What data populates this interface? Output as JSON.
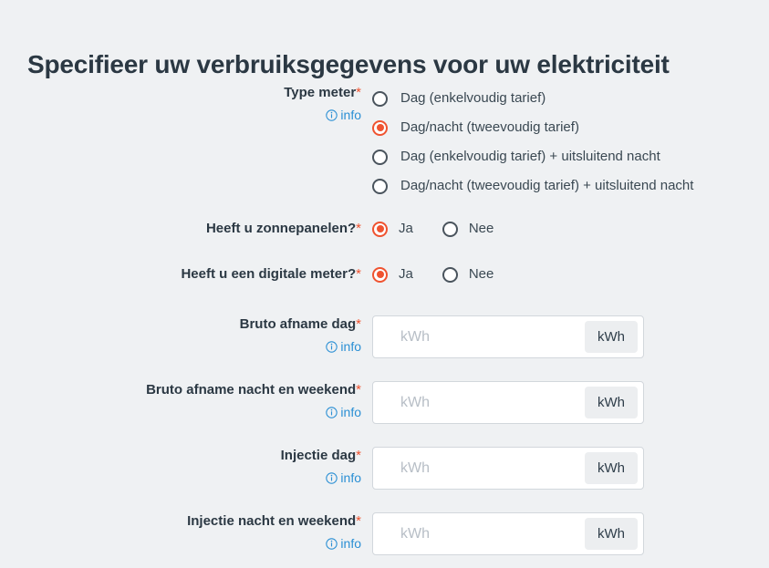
{
  "page": {
    "title": "Specifieer uw verbruiksgegevens voor uw elektriciteit",
    "background_color": "#eff1f3",
    "accent_color": "#ef5330",
    "link_color": "#2a8fd4",
    "required_marker": "*",
    "info_label": "info",
    "info_icon": "info-circle-icon"
  },
  "fields": {
    "meter_type": {
      "label": "Type meter",
      "required_marker": "*",
      "info_label": "info",
      "options": [
        {
          "label": "Dag (enkelvoudig tarief)",
          "selected": false
        },
        {
          "label": "Dag/nacht (tweevoudig tarief)",
          "selected": true
        },
        {
          "label": "Dag (enkelvoudig tarief) + uitsluitend nacht",
          "selected": false
        },
        {
          "label": "Dag/nacht (tweevoudig tarief) + uitsluitend nacht",
          "selected": false
        }
      ]
    },
    "solar_panels": {
      "label": "Heeft u zonnepanelen?",
      "required_marker": "*",
      "options": [
        {
          "label": "Ja",
          "selected": true
        },
        {
          "label": "Nee",
          "selected": false
        }
      ]
    },
    "digital_meter": {
      "label": "Heeft u een digitale meter?",
      "required_marker": "*",
      "options": [
        {
          "label": "Ja",
          "selected": true
        },
        {
          "label": "Nee",
          "selected": false
        }
      ]
    },
    "gross_offtake_day": {
      "label": "Bruto afname dag",
      "required_marker": "*",
      "info_label": "info",
      "value": "",
      "placeholder": "kWh",
      "unit": "kWh"
    },
    "gross_offtake_night_weekend": {
      "label": "Bruto afname nacht en weekend",
      "required_marker": "*",
      "info_label": "info",
      "value": "",
      "placeholder": "kWh",
      "unit": "kWh"
    },
    "injection_day": {
      "label": "Injectie dag",
      "required_marker": "*",
      "info_label": "info",
      "value": "",
      "placeholder": "kWh",
      "unit": "kWh"
    },
    "injection_night_weekend": {
      "label": "Injectie nacht en weekend",
      "required_marker": "*",
      "info_label": "info",
      "value": "",
      "placeholder": "kWh",
      "unit": "kWh"
    }
  }
}
